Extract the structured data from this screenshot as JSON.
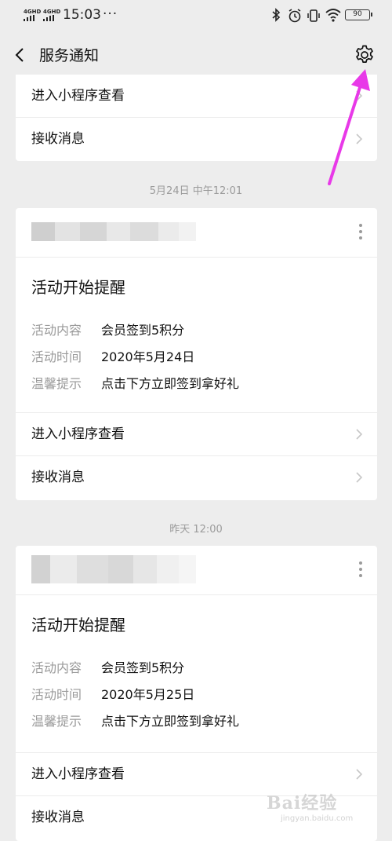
{
  "status_bar": {
    "signal_1": "4GHD",
    "signal_2": "4GHD",
    "time": "15:03",
    "more": "···",
    "battery": "90"
  },
  "nav": {
    "title": "服务通知"
  },
  "top_card": {
    "rows": [
      "进入小程序查看",
      "接收消息"
    ]
  },
  "messages": [
    {
      "timestamp": "5月24日 中午12:01",
      "title": "活动开始提醒",
      "details": [
        {
          "label": "活动内容",
          "value": "会员签到5积分"
        },
        {
          "label": "活动时间",
          "value": "2020年5月24日"
        },
        {
          "label": "温馨提示",
          "value": "点击下方立即签到拿好礼"
        }
      ],
      "actions": [
        "进入小程序查看",
        "接收消息"
      ]
    },
    {
      "timestamp": "昨天 12:00",
      "title": "活动开始提醒",
      "details": [
        {
          "label": "活动内容",
          "value": "会员签到5积分"
        },
        {
          "label": "活动时间",
          "value": "2020年5月25日"
        },
        {
          "label": "温馨提示",
          "value": "点击下方立即签到拿好礼"
        }
      ],
      "actions": [
        "进入小程序查看",
        "接收消息"
      ]
    }
  ],
  "watermark": {
    "text": "Bai经验",
    "sub": "jingyan.baidu.com"
  },
  "colors": {
    "background": "#ededed",
    "card": "#ffffff",
    "annotation_arrow": "#e839e8"
  },
  "icons": {
    "back": "chevron-left-icon",
    "settings": "gear-icon",
    "more": "vertical-dots-icon",
    "row_chevron": "chevron-right-icon"
  }
}
